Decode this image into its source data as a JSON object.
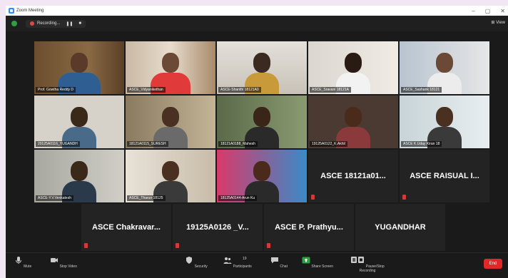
{
  "window": {
    "title": "Zoom Meeting"
  },
  "topbar": {
    "recording_label": "Recording...",
    "view_label": "View"
  },
  "participants": [
    {
      "name": "Prof. Gowtha Reddy D",
      "video": true,
      "active": true
    },
    {
      "name": "ASCE_Vidyanikethan",
      "video": true
    },
    {
      "name": "ASCE-Shanthi 18121A0",
      "video": true
    },
    {
      "name": "ASCE_Sravani 18121A",
      "video": true
    },
    {
      "name": "ASCE_Sashank 18121",
      "video": true
    },
    {
      "name": "20125A0116_YUGANDH",
      "video": true
    },
    {
      "name": "18121A0115_SURESH",
      "video": true
    },
    {
      "name": "18121A0188_Mahesh",
      "video": true
    },
    {
      "name": "19125A0122_K.Akhil",
      "video": true
    },
    {
      "name": "ASCE K.Uday Kiran 18",
      "video": true
    },
    {
      "name": "ASCE-Y.V.Venkatesh",
      "video": true
    },
    {
      "name": "ASCE_Tharun 18125",
      "video": true
    },
    {
      "name": "18125A0144-Arun Ku",
      "video": true
    },
    {
      "name": "ASCE 18121a01...",
      "video": false
    },
    {
      "name": "ASCE RAISUAL I...",
      "video": false
    },
    {
      "name": "ASCE Chakravar...",
      "video": false
    },
    {
      "name": "19125A0126 _V...",
      "video": false
    },
    {
      "name": "ASCE P. Prathyu...",
      "video": false
    },
    {
      "name": "YUGANDHAR",
      "video": false
    }
  ],
  "toolbar": {
    "mute": "Mute",
    "stop_video": "Stop Video",
    "security": "Security",
    "participants": "Participants",
    "participants_count": "19",
    "chat": "Chat",
    "share_screen": "Share Screen",
    "pause_recording": "Pause/Stop Recording",
    "end": "End"
  },
  "colors": {
    "share_green": "#2ea043",
    "end_red": "#e02828",
    "active_outline": "#e6d34a"
  }
}
